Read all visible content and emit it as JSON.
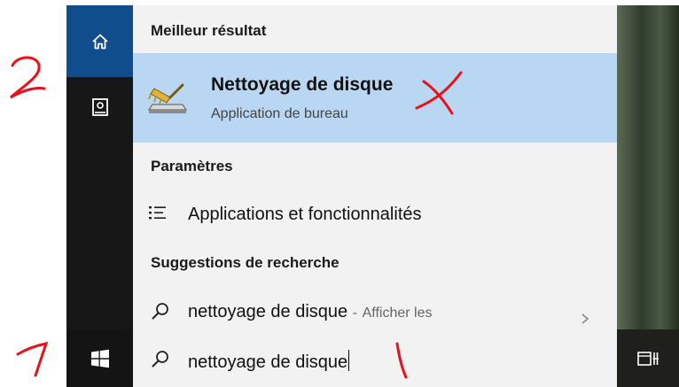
{
  "panel": {
    "best_header": "Meilleur résultat",
    "best_title": "Nettoyage de disque",
    "best_subtitle": "Application de bureau",
    "settings_header": "Paramètres",
    "settings_item": "Applications et fonctionnalités",
    "suggest_header": "Suggestions de recherche",
    "suggest_query": "nettoyage de disque",
    "suggest_separator": "-",
    "suggest_hint": "Afficher les"
  },
  "taskbar": {
    "search_value": "nettoyage de disque"
  },
  "icons": {
    "home": "home-icon",
    "document": "document-icon",
    "app": "disk-cleanup-icon",
    "settings": "list-icon",
    "search": "search-icon",
    "start": "windows-start-icon",
    "task_view": "task-view-icon",
    "chevron": "chevron-right-icon"
  },
  "colors": {
    "rail": "#171717",
    "home_active": "#0f4d8c",
    "highlight": "#b9d7f2",
    "panel": "#f2f2f2",
    "annotation": "#e8121b"
  }
}
